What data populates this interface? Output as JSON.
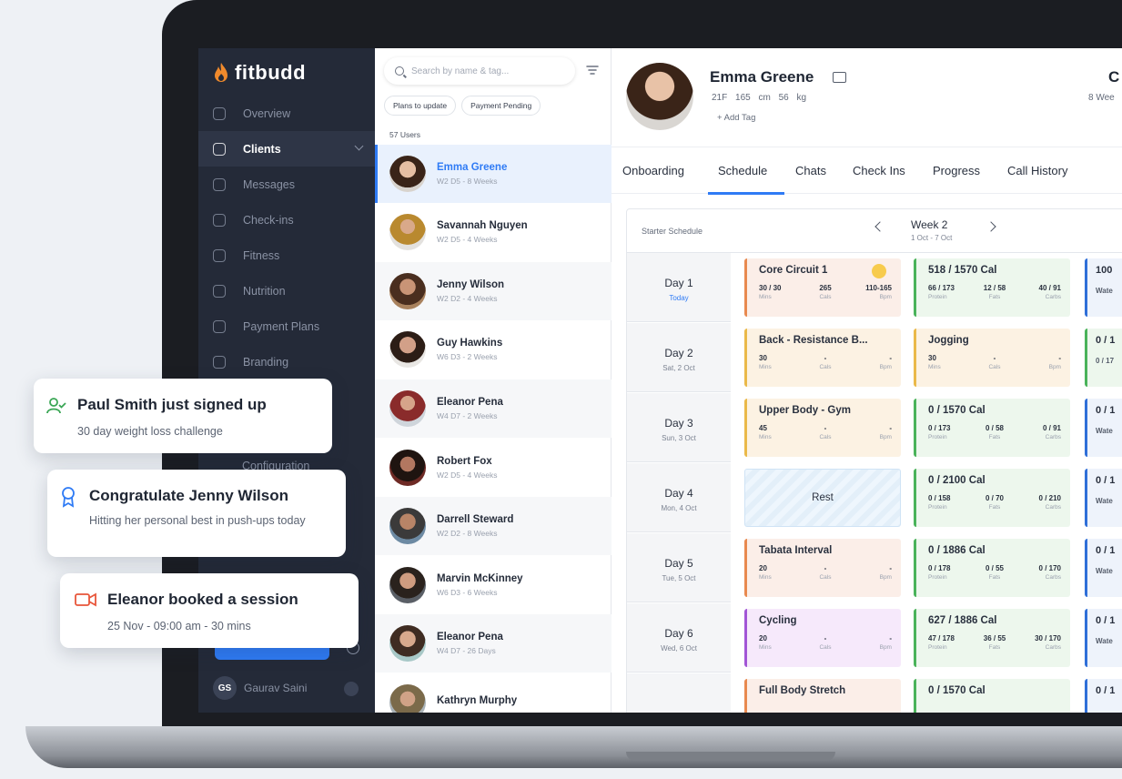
{
  "app": {
    "brand": "fitbudd",
    "nav": [
      {
        "label": "Overview",
        "icon": "grid-icon",
        "active": false
      },
      {
        "label": "Clients",
        "icon": "users-icon",
        "active": true
      },
      {
        "label": "Messages",
        "icon": "message-icon",
        "active": false
      },
      {
        "label": "Check-ins",
        "icon": "check-icon",
        "active": false
      },
      {
        "label": "Fitness",
        "icon": "dumbbell-icon",
        "active": false
      },
      {
        "label": "Nutrition",
        "icon": "fork-knife-icon",
        "active": false
      },
      {
        "label": "Payment Plans",
        "icon": "payment-icon",
        "active": false
      },
      {
        "label": "Branding",
        "icon": "brand-icon",
        "active": false
      }
    ],
    "nav_partial": "Configuration",
    "user": {
      "initials": "GS",
      "name": "Gaurav Saini"
    }
  },
  "clients": {
    "search_placeholder": "Search by name & tag...",
    "chips": [
      "Plans to update",
      "Payment Pending"
    ],
    "count": "57 Users",
    "list": [
      {
        "name": "Emma Greene",
        "sub": "W2 D5 - 8 Weeks",
        "active": true
      },
      {
        "name": "Savannah Nguyen",
        "sub": "W2 D5 - 4 Weeks"
      },
      {
        "name": "Jenny Wilson",
        "sub": "W2 D2 - 4 Weeks"
      },
      {
        "name": "Guy Hawkins",
        "sub": "W6 D3 - 2 Weeks"
      },
      {
        "name": "Eleanor Pena",
        "sub": "W4 D7 - 2 Weeks"
      },
      {
        "name": "Robert Fox",
        "sub": "W2 D5 - 4 Weeks"
      },
      {
        "name": "Darrell Steward",
        "sub": "W2 D2 - 8 Weeks"
      },
      {
        "name": "Marvin McKinney",
        "sub": "W6 D3 - 6 Weeks"
      },
      {
        "name": "Eleanor Pena",
        "sub": "W4 D7 - 26 Days"
      },
      {
        "name": "Kathryn Murphy",
        "sub": ""
      }
    ]
  },
  "profile": {
    "name": "Emma Greene",
    "meta": "21F 165 cm 56 kg",
    "add_tag": "+ Add Tag",
    "right_title": "C",
    "right_sub": "8 Wee"
  },
  "tabs": [
    "Onboarding",
    "Schedule",
    "Chats",
    "Check Ins",
    "Progress",
    "Call History"
  ],
  "schedule": {
    "label": "Starter Schedule",
    "week": "Week 2",
    "week_range": "1 Oct - 7 Oct",
    "days": [
      {
        "name": "Day 1",
        "sub": "Today"
      },
      {
        "name": "Day 2",
        "sub": "Sat, 2 Oct"
      },
      {
        "name": "Day 3",
        "sub": "Sun, 3 Oct"
      },
      {
        "name": "Day 4",
        "sub": "Mon, 4 Oct"
      },
      {
        "name": "Day 5",
        "sub": "Tue, 5 Oct"
      },
      {
        "name": "Day 6",
        "sub": "Wed, 6 Oct"
      }
    ],
    "workouts": [
      {
        "title": "Core Circuit 1",
        "stats": [
          "30 / 30",
          "265",
          "110-165"
        ],
        "labels": [
          "Mins",
          "Cals",
          "Bpm"
        ]
      },
      {
        "title": "Back - Resistance B...",
        "stats": [
          "30",
          "-",
          "-"
        ],
        "labels": [
          "Mins",
          "Cals",
          "Bpm"
        ]
      },
      {
        "title": "Upper Body - Gym",
        "stats": [
          "45",
          "-",
          "-"
        ],
        "labels": [
          "Mins",
          "Cals",
          "Bpm"
        ]
      },
      {
        "title": "Rest"
      },
      {
        "title": "Tabata Interval",
        "stats": [
          "20",
          "-",
          "-"
        ],
        "labels": [
          "Mins",
          "Cals",
          "Bpm"
        ]
      },
      {
        "title": "Cycling",
        "stats": [
          "20",
          "-",
          "-"
        ],
        "labels": [
          "Mins",
          "Cals",
          "Bpm"
        ]
      },
      {
        "title": "Full Body Stretch"
      }
    ],
    "nutrition": [
      {
        "title": "518 / 1570 Cal",
        "stats": [
          "66 / 173",
          "12 / 58",
          "40 / 91"
        ],
        "labels": [
          "Protein",
          "Fats",
          "Carbs"
        ]
      },
      {
        "title": "Jogging",
        "stats": [
          "30",
          "-",
          "-"
        ],
        "labels": [
          "Mins",
          "Cals",
          "Bpm"
        ]
      },
      {
        "title": "0 / 1570 Cal",
        "stats": [
          "0 / 173",
          "0 / 58",
          "0 / 91"
        ],
        "labels": [
          "Protein",
          "Fats",
          "Carbs"
        ]
      },
      {
        "title": "0 / 2100 Cal",
        "stats": [
          "0 / 158",
          "0 / 70",
          "0 / 210"
        ],
        "labels": [
          "Protein",
          "Fats",
          "Carbs"
        ]
      },
      {
        "title": "0 / 1886 Cal",
        "stats": [
          "0 / 178",
          "0 / 55",
          "0 / 170"
        ],
        "labels": [
          "Protein",
          "Fats",
          "Carbs"
        ]
      },
      {
        "title": "627 / 1886 Cal",
        "stats": [
          "47 / 178",
          "36 / 55",
          "30 / 170"
        ],
        "labels": [
          "Protein",
          "Fats",
          "Carbs"
        ]
      },
      {
        "title": "0 / 1570 Cal"
      }
    ],
    "third": [
      {
        "title": "100",
        "sub": "Wate"
      },
      {
        "title": "0 / 1",
        "sub": "0 / 17"
      },
      {
        "title": "0 / 1",
        "sub": "Wate"
      },
      {
        "title": "0 / 1",
        "sub": "Wate"
      },
      {
        "title": "0 / 1",
        "sub": "Wate"
      },
      {
        "title": "0 / 1",
        "sub": "Wate"
      },
      {
        "title": "0 / 1",
        "sub": ""
      }
    ]
  },
  "notifications": [
    {
      "title": "Paul Smith just signed up",
      "body": "30 day weight loss challenge",
      "icon": "user-check-icon"
    },
    {
      "title": "Congratulate Jenny Wilson",
      "body": "Hitting her personal best in push-ups today",
      "icon": "award-icon"
    },
    {
      "title": "Eleanor booked a session",
      "body": "25 Nov - 09:00 am - 30 mins",
      "icon": "video-icon"
    }
  ],
  "colors": {
    "accent": "#2f7bf5",
    "sidebar": "#242a38",
    "workout_orange": "#e8894f",
    "workout_yellow": "#eab949",
    "workout_purple": "#a255d6",
    "nutrition_green": "#4ab35a",
    "third_blue": "#2f6fd8"
  }
}
